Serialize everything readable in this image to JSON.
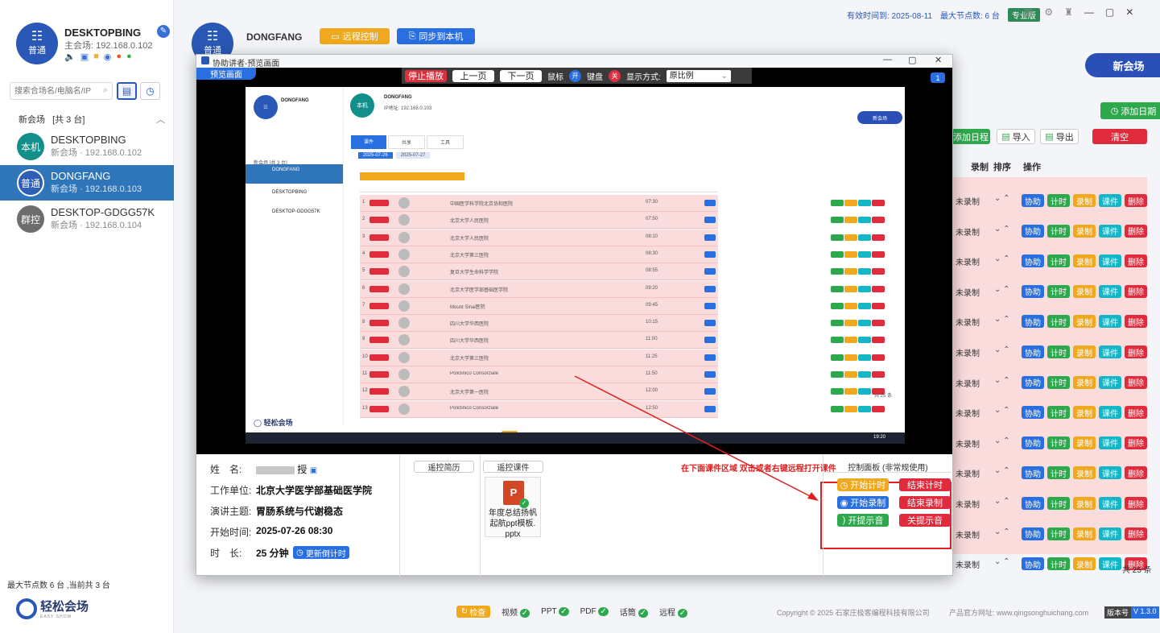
{
  "app": {
    "header": {
      "valid_until": "有效时间到: 2025-08-11",
      "max_nodes": "最大节点数: 6 台",
      "edition_badge": "专业版"
    },
    "host": {
      "name": "DESKTOPBING",
      "ip": "主会场: 192.168.0.102",
      "role": "普通"
    },
    "remote": {
      "name": "DONGFANG",
      "ip": "IP地址: 192.168.0.103",
      "role": "普通",
      "remote_control_label": "远程控制",
      "sync_label": "同步到本机"
    },
    "new_venue_button": "新会场",
    "sidebar": {
      "search_placeholder": "搜索合场名/电脑名/IP",
      "group_label": "新会场",
      "group_count": "[共 3 台]",
      "devices": [
        {
          "badge": "本机",
          "name": "DESKTOPBING",
          "sub": "新会场 · 192.168.0.102",
          "color": "#138f8b"
        },
        {
          "badge": "普通",
          "name": "DONGFANG",
          "sub": "新会场 · 192.168.0.103",
          "color": "#2d5fb8"
        },
        {
          "badge": "群控",
          "name": "DESKTOP-GDGG57K",
          "sub": "新会场 · 192.168.0.104",
          "color": "#6d6d6d"
        }
      ],
      "footer_text": "最大节点数 6 台 ,当前共 3 台",
      "logo_text": "轻松会场",
      "logo_sub": "EASY SHOW"
    },
    "toolbar": {
      "add_date": "添加日期",
      "add_schedule": "添加日程",
      "import": "导入",
      "export": "导出",
      "clear": "清空"
    },
    "table": {
      "headers": {
        "record": "录制",
        "sort": "排序",
        "ops": "操作"
      },
      "row_status": "未录制",
      "actions": [
        "协助",
        "计时",
        "录制",
        "课件",
        "删除"
      ],
      "total": "共 25 条"
    },
    "bottom_bar": {
      "check": "检查",
      "items": [
        "视频",
        "PPT",
        "PDF",
        "话筒",
        "远程"
      ],
      "copyright": "Copyright © 2025 石家庄极客编程科技有限公司",
      "website": "产品官方网址: www.qingsonghuichang.com",
      "version_label": "版本号",
      "version": "V 1.3.0"
    }
  },
  "popup": {
    "title": "协助讲者-预览画面",
    "preview_tab": "预览画面",
    "stop_play": "停止播放",
    "prev_page": "上一页",
    "next_page": "下一页",
    "mouse_label": "鼠标",
    "mouse_state": "开",
    "keyboard_label": "键盘",
    "keyboard_state": "关",
    "display_mode_label": "显示方式:",
    "display_mode": "原比例",
    "screen_index": "1",
    "info": {
      "name_label": "姓　名:",
      "name_value": "授",
      "unit_label": "工作单位:",
      "unit_value": "北京大学医学部基础医学院",
      "topic_label": "演讲主题:",
      "topic_value": "胃肠系统与代谢稳态",
      "start_label": "开始时间:",
      "start_value": "2025-07-26 08:30",
      "duration_label": "时　长:",
      "duration_value": "25 分钟",
      "update_timer": "更新倒计时"
    },
    "remote_resume": "遥控简历",
    "remote_slides": "遥控课件",
    "hint": "在下面课件区域 双击或者右键远程打开课件",
    "file_name": "年度总结扬帆起航ppt模板.pptx",
    "panel_title": "控制面板 (非常规使用)",
    "controls": {
      "start_timer": "开始计时",
      "end_timer": "结束计时",
      "start_record": "开始录制",
      "end_record": "结束录制",
      "start_prompt": "开提示音",
      "close_prompt": "关提示音"
    },
    "inner": {
      "name": "DONGFANG",
      "ip": "IP地址: 192.168.0.103",
      "host_name": "DONGFANG",
      "badge": "本机",
      "new_venue": "新会场",
      "group": "新会场 [共 3 台]",
      "devices": [
        "DONGFANG",
        "DESKTOPBING",
        "DESKTOP-GDGG57K"
      ],
      "tabs": [
        "课件",
        "共享",
        "工具"
      ],
      "dates": [
        "2025-07-26",
        "2025-07-27"
      ],
      "row_times": [
        "07:30",
        "07:50",
        "08:10",
        "08:30",
        "08:55",
        "09:20",
        "09:45",
        "10:15",
        "11:00",
        "11:25",
        "11:50",
        "12:00",
        "12:50"
      ],
      "row_units": [
        "中国医学科学院北京协和医院",
        "北京大学人民医院",
        "北京大学人民医院",
        "北京大学第三医院",
        "复旦大学生命科学学院",
        "北京大学医学部基础医学院",
        "Mount Sinai医院",
        "四川大学华西医院",
        "四川大学华西医院",
        "北京大学第三医院",
        "Policlinico Consorziale",
        "北京大学第一医院",
        "Policlinico Consorziale"
      ],
      "total": "共 25 条",
      "taskbar_time": "19:20"
    }
  }
}
